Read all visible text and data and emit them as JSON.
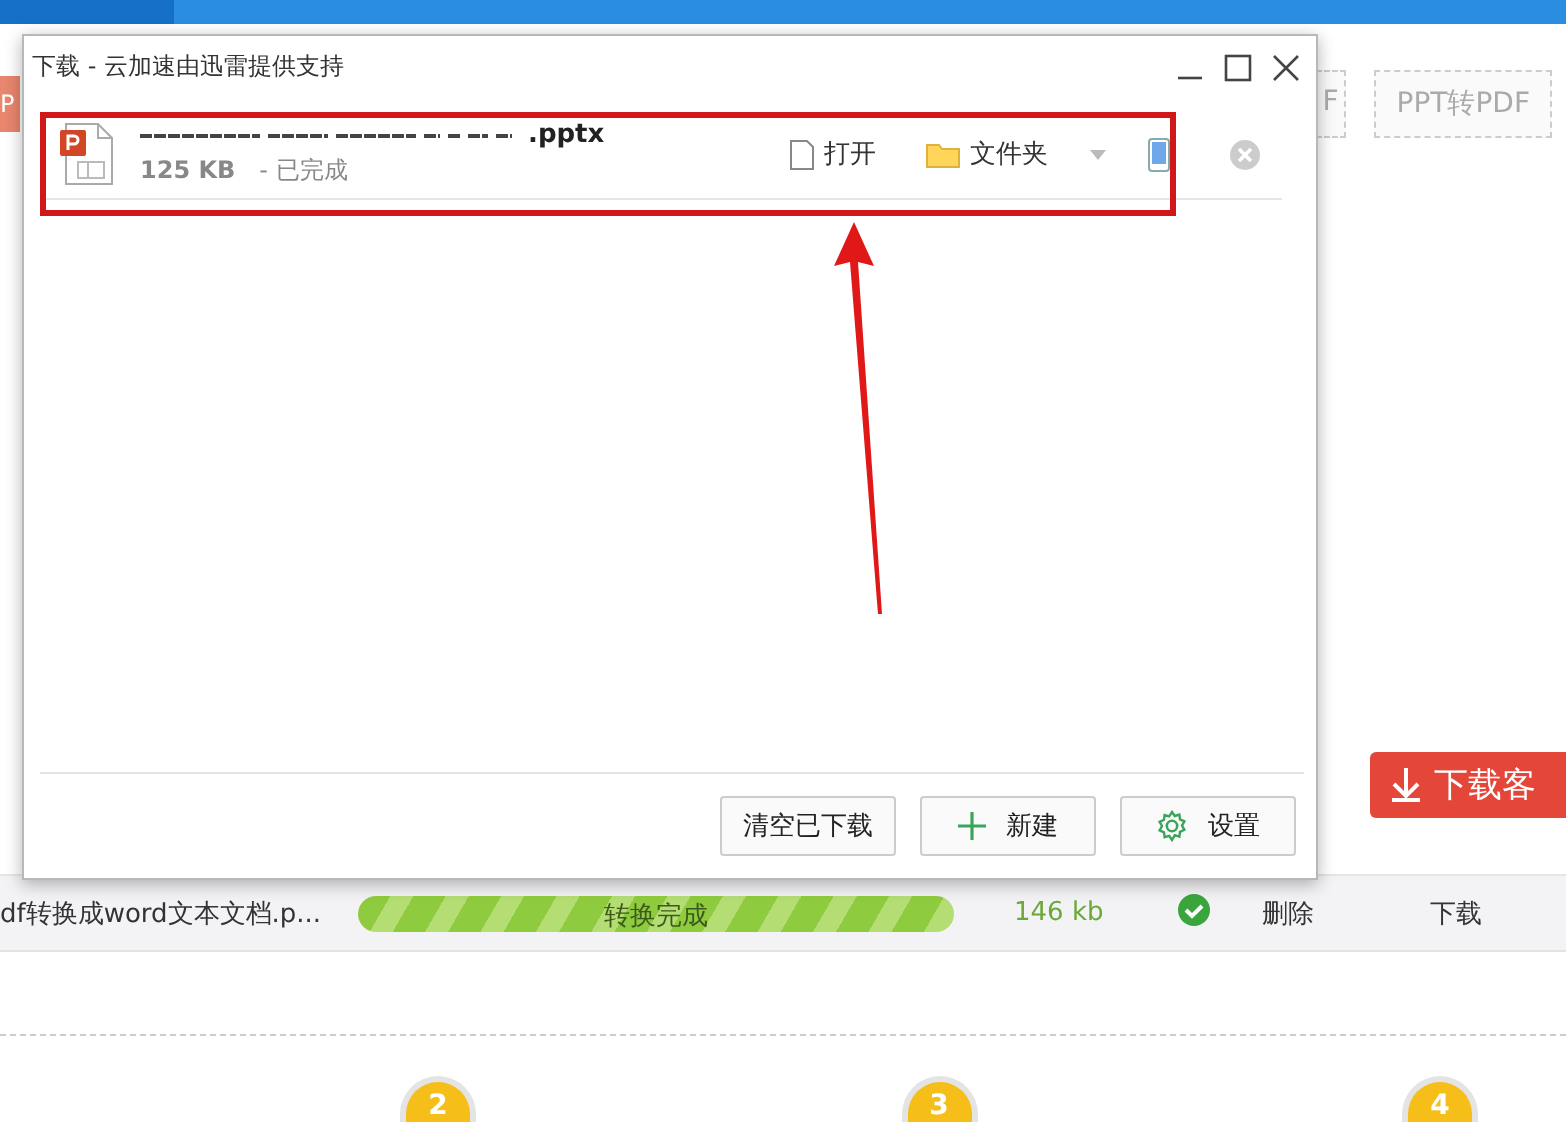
{
  "background": {
    "toolbar_left": "P",
    "toolbar_buttons": [
      "F",
      "PPT转PDF"
    ],
    "client_button": "下载客",
    "file_row": {
      "name": "df转换成word文本文档.p...",
      "progress": {
        "level": 1,
        "label": "转换完成"
      },
      "size": "146 kb",
      "done": true,
      "delete": "删除",
      "download": "下载"
    },
    "steps": [
      "2",
      "3",
      "4"
    ]
  },
  "window": {
    "title": "下载 - 云加速由迅雷提供支持"
  },
  "downloads": [
    {
      "file_extension": ".pptx",
      "size": "125 KB",
      "status": "- 已完成",
      "open": "打开",
      "folder": "文件夹"
    }
  ],
  "footer_buttons": [
    {
      "kind": "clear",
      "label": "清空已下载"
    },
    {
      "kind": "new",
      "label": "新建"
    },
    {
      "kind": "settings",
      "label": "设置"
    }
  ]
}
